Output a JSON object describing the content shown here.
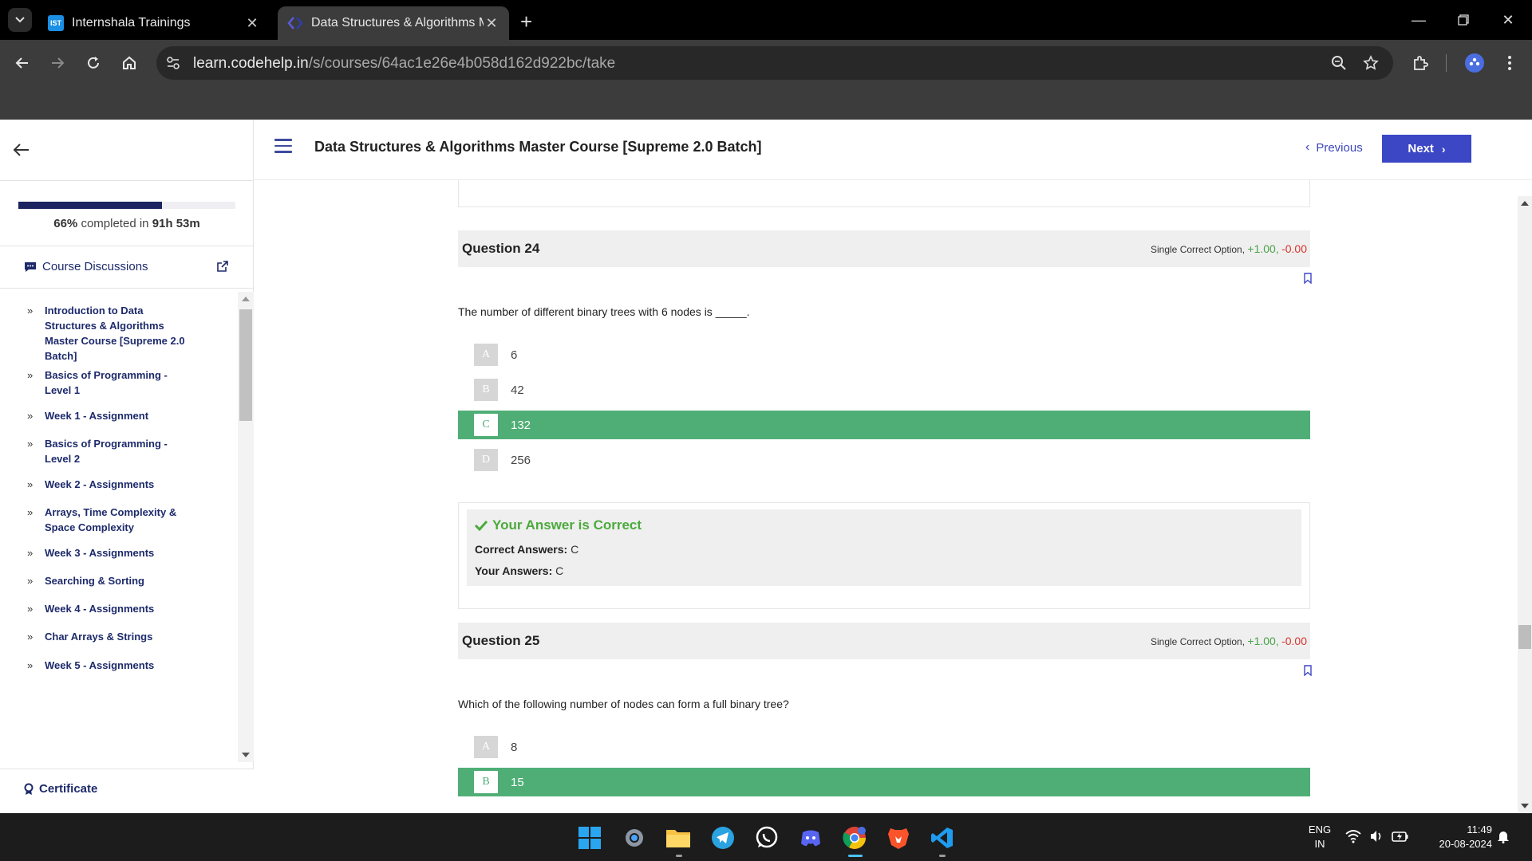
{
  "browser": {
    "tabs": [
      {
        "title": "Internshala Trainings",
        "favicon": "IST",
        "active": false
      },
      {
        "title": "Data Structures & Algorithms M",
        "favicon": "codehelp-icon",
        "active": true
      }
    ],
    "url": {
      "host": "learn.codehelp.in",
      "path": "/s/courses/64ac1e26e4b058d162d922bc/take"
    }
  },
  "sidebar": {
    "progress": {
      "percent": 66,
      "percent_label": "66%",
      "text": "completed in",
      "time": "91h 53m"
    },
    "discussions_label": "Course Discussions",
    "items": [
      {
        "label": "Introduction to Data Structures & Algorithms Master Course [Supreme 2.0 Batch]"
      },
      {
        "label": "Basics of Programming - Level 1"
      },
      {
        "label": "Week 1 - Assignment"
      },
      {
        "label": "Basics of Programming - Level 2"
      },
      {
        "label": "Week 2 - Assignments"
      },
      {
        "label": "Arrays, Time Complexity & Space Complexity"
      },
      {
        "label": "Week 3 - Assignments"
      },
      {
        "label": "Searching & Sorting"
      },
      {
        "label": "Week 4 - Assignments"
      },
      {
        "label": "Char Arrays & Strings"
      },
      {
        "label": "Week 5 - Assignments"
      }
    ],
    "certificate_label": "Certificate"
  },
  "header": {
    "course_title": "Data Structures & Algorithms Master Course [Supreme 2.0 Batch]",
    "previous_label": "Previous",
    "next_label": "Next"
  },
  "questions": [
    {
      "label": "Question 24",
      "type": "Single Correct Option,",
      "positive": "+1.00,",
      "negative": "-0.00",
      "text": "The number of different binary trees with 6 nodes is _____.",
      "options": [
        {
          "letter": "A",
          "value": "6",
          "correct": false
        },
        {
          "letter": "B",
          "value": "42",
          "correct": false
        },
        {
          "letter": "C",
          "value": "132",
          "correct": true
        },
        {
          "letter": "D",
          "value": "256",
          "correct": false
        }
      ],
      "result": {
        "title": "Your Answer is Correct",
        "correct_label": "Correct Answers:",
        "correct_value": "C",
        "your_label": "Your Answers:",
        "your_value": "C"
      }
    },
    {
      "label": "Question 25",
      "type": "Single Correct Option,",
      "positive": "+1.00,",
      "negative": "-0.00",
      "text": "Which of the following number of nodes can form a full binary tree?",
      "options": [
        {
          "letter": "A",
          "value": "8",
          "correct": false
        },
        {
          "letter": "B",
          "value": "15",
          "correct": true
        }
      ]
    }
  ],
  "taskbar": {
    "apps": [
      "windows-start-icon",
      "settings-icon",
      "file-explorer-icon",
      "telegram-icon",
      "whatsapp-icon",
      "discord-icon",
      "chrome-icon",
      "brave-icon",
      "vscode-icon"
    ],
    "lang_top": "ENG",
    "lang_bottom": "IN",
    "time": "11:49",
    "date": "20-08-2024"
  },
  "colors": {
    "accent": "#3c47c6",
    "correct_green": "#4fae75",
    "progress": "#1c2361",
    "positive_mark": "#48a148",
    "negative_mark": "#d9342b"
  }
}
